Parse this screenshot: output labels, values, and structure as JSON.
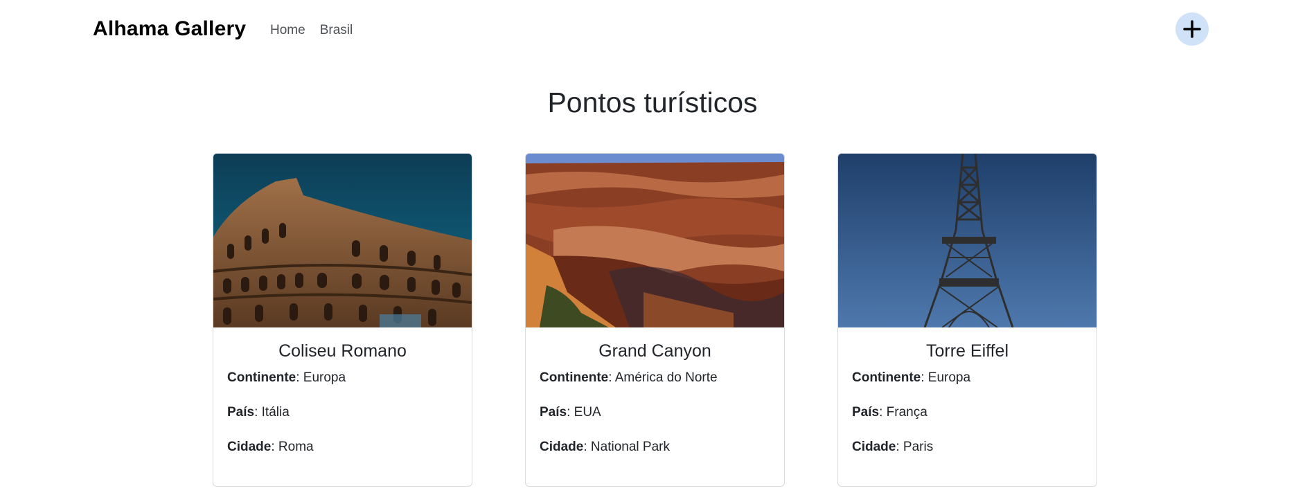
{
  "nav": {
    "brand": "Alhama Gallery",
    "links": [
      "Home",
      "Brasil"
    ],
    "add_icon": "plus-icon"
  },
  "page": {
    "title": "Pontos turísticos"
  },
  "labels": {
    "continent": "Continente",
    "country": "País",
    "city": "Cidade",
    "separator": ": "
  },
  "cards": [
    {
      "name": "Coliseu Romano",
      "continent": "Europa",
      "country": "Itália",
      "city": "Roma",
      "image": "colosseum-photo"
    },
    {
      "name": "Grand Canyon",
      "continent": "América do Norte",
      "country": "EUA",
      "city": "National Park",
      "image": "grand-canyon-photo"
    },
    {
      "name": "Torre Eiffel",
      "continent": "Europa",
      "country": "França",
      "city": "Paris",
      "image": "eiffel-tower-photo"
    }
  ],
  "colors": {
    "add_button_bg": "#cfe2f7",
    "text": "#212529",
    "nav_link": "#4d5156",
    "card_border": "#d7d9dc"
  }
}
